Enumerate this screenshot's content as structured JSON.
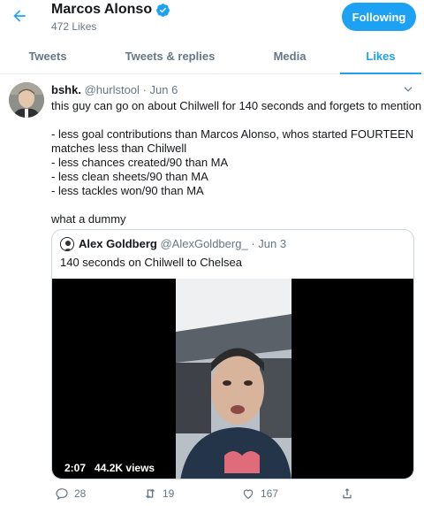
{
  "header": {
    "back_icon": "arrow-left-icon",
    "profile_name": "Marcos Alonso",
    "verified_icon": "verified-badge-icon",
    "likes_count": "472 Likes",
    "follow_label": "Following"
  },
  "tabs": [
    {
      "label": "Tweets",
      "active": false
    },
    {
      "label": "Tweets & replies",
      "active": false
    },
    {
      "label": "Media",
      "active": false
    },
    {
      "label": "Likes",
      "active": true
    }
  ],
  "tweet": {
    "name": "bshk.",
    "handle": "@hurlstool",
    "time": "· Jun 6",
    "lines": [
      "this guy can go on about Chilwell for 140 seconds and forgets to mention",
      "",
      "- less goal contributions than Marcos Alonso, whos started FOURTEEN",
      "matches less than Chilwell",
      "- less chances created/90 than MA",
      "- less clean sheets/90 than MA",
      "- less tackles won/90 than MA",
      "",
      "what a dummy"
    ],
    "quote": {
      "name": "Alex Goldberg",
      "handle": "@AlexGoldberg_",
      "time": "· Jun 3",
      "text": "140 seconds on Chilwell to Chelsea",
      "video_duration": "2:07",
      "video_views": "44.2K views"
    },
    "actions": {
      "replies": "28",
      "retweets": "19",
      "likes": "167"
    }
  },
  "colors": {
    "accent": "#1da1f2",
    "text": "#14171a",
    "muted": "#657786",
    "border": "#e6ecf0"
  }
}
